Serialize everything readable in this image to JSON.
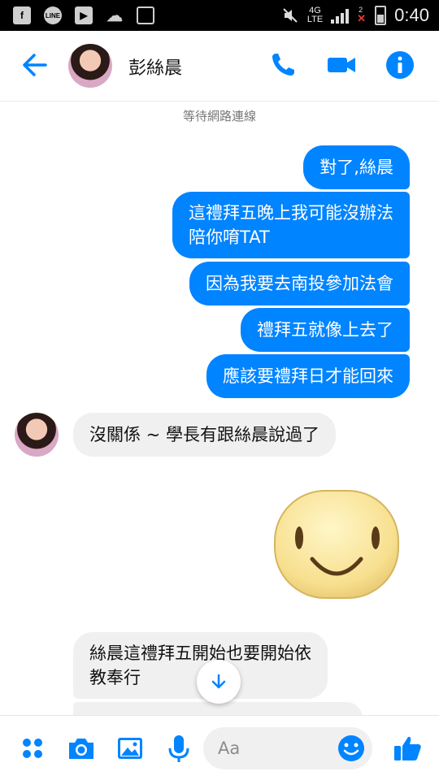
{
  "status_bar": {
    "network": "4G\nLTE",
    "sim_slot": "2",
    "time": "0:40",
    "left_icons": [
      "facebook-icon",
      "line-icon",
      "youtube-icon",
      "weather-icon",
      "image-icon"
    ]
  },
  "header": {
    "contact_name": "彭絲晨",
    "accent_color": "#0084ff"
  },
  "connection_status": "等待網路連線",
  "messages": {
    "out_1": "對了,絲晨",
    "out_2_line1": "這禮拜五晚上我可能沒辦法",
    "out_2_line2": "陪你唷TAT",
    "out_3": "因為我要去南投參加法會",
    "out_4": "禮拜五就像上去了",
    "out_5": "應該要禮拜日才能回來",
    "in_1": "沒關係 ~ 學長有跟絲晨說過了",
    "in_2_line1": "絲晨這禮拜五開始也要開始依",
    "in_2_line2": "教奉行"
  },
  "composer": {
    "placeholder": "Aa"
  }
}
